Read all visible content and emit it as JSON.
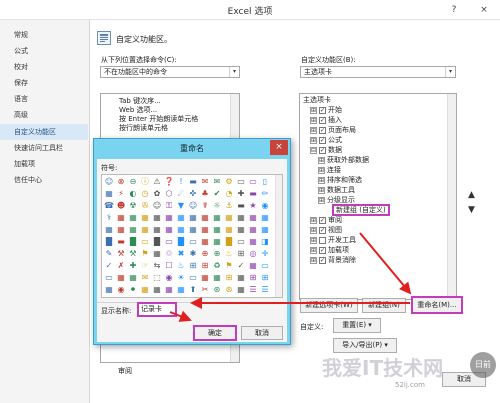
{
  "window": {
    "title": "Excel 选项",
    "help": "?",
    "close": "×"
  },
  "sidebar": {
    "items": [
      {
        "label": "常规"
      },
      {
        "label": "公式"
      },
      {
        "label": "校对"
      },
      {
        "label": "保存"
      },
      {
        "label": "语言"
      },
      {
        "label": "高级"
      },
      {
        "label": "自定义功能区",
        "selected": true
      },
      {
        "label": "快速访问工具栏"
      },
      {
        "label": "加载项"
      },
      {
        "label": "信任中心"
      }
    ]
  },
  "main": {
    "header": "自定义功能区。",
    "left_label": "从下列位置选择命令(C):",
    "left_select": "不在功能区中的命令",
    "left_list": [
      "Tab 键次序...",
      "Web 选项...",
      "按 Enter 开始朗读单元格",
      "按行朗读单元格"
    ],
    "right_label": "自定义功能区(B):",
    "right_select": "主选项卡",
    "tree": [
      {
        "label": "主选项卡",
        "level": 0,
        "type": "header"
      },
      {
        "label": "开始",
        "level": 1,
        "type": "check",
        "exp": "⊞"
      },
      {
        "label": "插入",
        "level": 1,
        "type": "check",
        "exp": "⊞"
      },
      {
        "label": "页面布局",
        "level": 1,
        "type": "check",
        "exp": "⊞"
      },
      {
        "label": "公式",
        "level": 1,
        "type": "check",
        "exp": "⊞"
      },
      {
        "label": "数据",
        "level": 1,
        "type": "check",
        "exp": "⊟"
      },
      {
        "label": "获取外部数据",
        "level": 2,
        "type": "exp",
        "exp": "⊞"
      },
      {
        "label": "连接",
        "level": 2,
        "type": "exp",
        "exp": "⊞"
      },
      {
        "label": "排序和筛选",
        "level": 2,
        "type": "exp",
        "exp": "⊞"
      },
      {
        "label": "数据工具",
        "level": 2,
        "type": "exp",
        "exp": "⊞"
      },
      {
        "label": "分级显示",
        "level": 2,
        "type": "exp",
        "exp": "⊞"
      },
      {
        "label": "新建组 (自定义)",
        "level": 2,
        "type": "highlight"
      },
      {
        "label": "审阅",
        "level": 1,
        "type": "check",
        "exp": "⊞"
      },
      {
        "label": "视图",
        "level": 1,
        "type": "check",
        "exp": "⊞"
      },
      {
        "label": "开发工具",
        "level": 1,
        "type": "check",
        "exp": "⊞",
        "unchecked": true
      },
      {
        "label": "加载项",
        "level": 1,
        "type": "check",
        "exp": "⊞"
      },
      {
        "label": "背景消除",
        "level": 1,
        "type": "check",
        "exp": "⊞"
      }
    ],
    "btn_new_tab": "新建选项卡(W)",
    "btn_new_group": "新建组(N)",
    "btn_rename": "重命名(M)...",
    "custom_label": "自定义:",
    "btn_reset": "重置(E) ▾",
    "btn_import": "导入/导出(P) ▾",
    "btn_cancel_main": "取消",
    "bottom_partial": "审阅"
  },
  "dialog": {
    "title": "重命名",
    "close": "×",
    "symbol_label": "符号:",
    "display_label": "显示名称:",
    "display_value": "记录卡",
    "ok": "确定",
    "cancel": "取消",
    "symbols": [
      "☺",
      "⊗",
      "⊖",
      "ⓘ",
      "⚠",
      "❓",
      "!",
      "▬",
      "✉",
      "✉",
      "⚙",
      "▭",
      "▭",
      "▯",
      "▦",
      "⚡",
      "◐",
      "◷",
      "✿",
      "⬡",
      "☄",
      "✜",
      "♣",
      "✔",
      "◔",
      "✚",
      "▬",
      "✏",
      "☎",
      "☻",
      "☢",
      "✇",
      "☺",
      "⚿",
      "▼",
      "☺",
      "☤",
      "☼",
      "⚓",
      "▬",
      "★",
      "◉",
      "⚕",
      "▦",
      "▦",
      "▦",
      "▦",
      "▦",
      "▦",
      "▦",
      "▦",
      "▦",
      "▦",
      "▦",
      "▦",
      "▦",
      "▦",
      "▦",
      "▦",
      "▦",
      "▦",
      "▦",
      "▦",
      "▦",
      "▦",
      "▦",
      "▦",
      "▦",
      "▦",
      "▦",
      "█",
      "▬",
      "█",
      "▭",
      "█",
      "▭",
      "█",
      "▭",
      "▦",
      "▦",
      "█",
      "▭",
      "▦",
      "◨",
      "✎",
      "⚒",
      "⚒",
      "⚑",
      "▦",
      "♲",
      "✖",
      "✱",
      "⊕",
      "⊕",
      "♨",
      "⊞",
      "◎",
      "✛",
      "✓",
      "✗",
      "✚",
      "☞",
      "⇆",
      "☐",
      "♨",
      "⊞",
      "⊞",
      "♻",
      "⚑",
      "✓",
      "▦",
      "▭",
      "▭",
      "▦",
      "▦",
      "✉",
      "⬚",
      "◉",
      "☀",
      "▭",
      "▦",
      "▦",
      "⊞",
      "▦",
      "⊞",
      "⊞",
      "▦",
      "◉",
      "⚫",
      "▦",
      "▦",
      "▦",
      "▦",
      "⬆",
      "✂",
      "⊛",
      "⊛",
      "▦",
      "☰",
      "☰"
    ]
  },
  "watermark": {
    "text": "我爱IT技术网",
    "site": "52ij.com",
    "badge": "日前"
  }
}
